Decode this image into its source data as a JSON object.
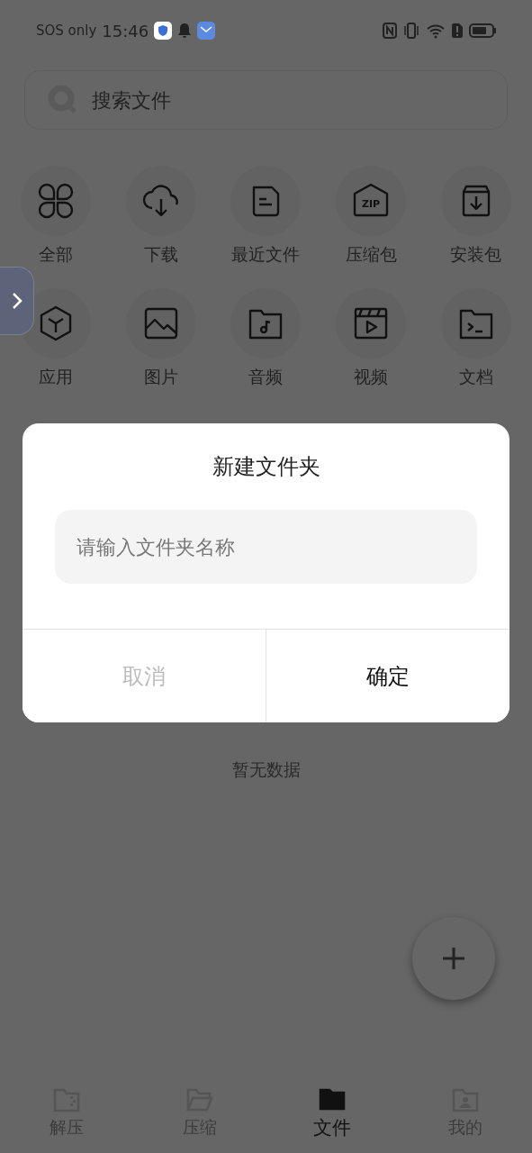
{
  "status_bar": {
    "carrier": "SOS only",
    "time": "15:46"
  },
  "search": {
    "placeholder": "搜索文件"
  },
  "categories": [
    {
      "kind": "all",
      "label": "全部"
    },
    {
      "kind": "download",
      "label": "下载"
    },
    {
      "kind": "recent",
      "label": "最近文件"
    },
    {
      "kind": "archive",
      "label": "压缩包",
      "icon_text": "ZIP"
    },
    {
      "kind": "installer",
      "label": "安装包"
    },
    {
      "kind": "app",
      "label": "应用"
    },
    {
      "kind": "image",
      "label": "图片"
    },
    {
      "kind": "audio",
      "label": "音频"
    },
    {
      "kind": "video",
      "label": "视频"
    },
    {
      "kind": "document",
      "label": "文档"
    }
  ],
  "empty_state": "暂无数据",
  "dialog": {
    "title": "新建文件夹",
    "input": {
      "placeholder": "请输入文件夹名称"
    },
    "buttons": [
      {
        "kind": "cancel",
        "label": "取消"
      },
      {
        "kind": "confirm",
        "label": "确定"
      }
    ]
  },
  "bottom_nav": [
    {
      "kind": "extract",
      "label": "解压",
      "selected": false
    },
    {
      "kind": "compress",
      "label": "压缩",
      "selected": false
    },
    {
      "kind": "files",
      "label": "文件",
      "selected": true
    },
    {
      "kind": "profile",
      "label": "我的",
      "selected": false
    }
  ]
}
